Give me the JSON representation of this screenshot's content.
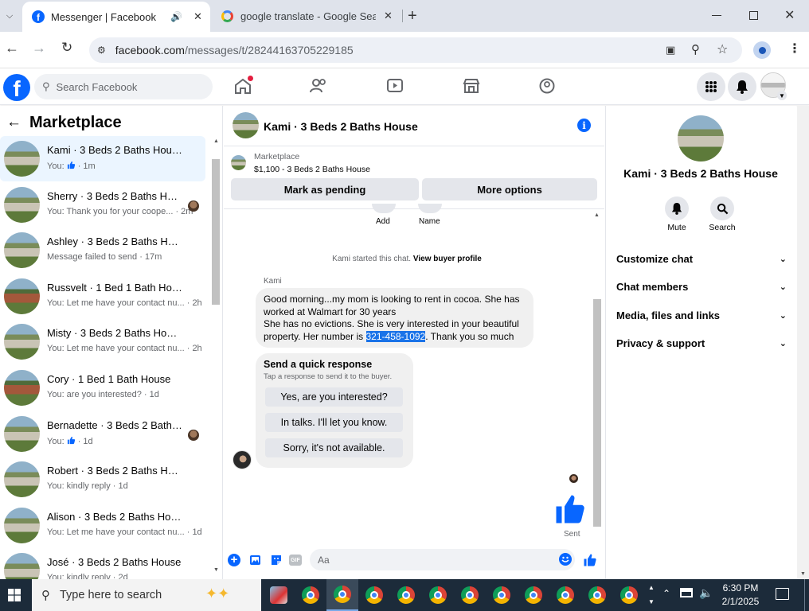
{
  "browser": {
    "tabs": [
      {
        "title": "Messenger | Facebook",
        "active": true
      },
      {
        "title": "google translate - Google Sear",
        "active": false
      }
    ],
    "url_domain": "facebook.com",
    "url_path": "/messages/t/28244163705229185"
  },
  "fb": {
    "search_placeholder": "Search Facebook"
  },
  "sidebar": {
    "title": "Marketplace",
    "conversations": [
      {
        "name": "Kami · 3 Beds 2 Baths House",
        "preview": "You:",
        "time": "· 1m",
        "thumb": "gray",
        "like": true
      },
      {
        "name": "Sherry · 3 Beds 2 Baths House",
        "preview": "You: Thank you for your coope...",
        "time": "· 2m",
        "thumb": "gray"
      },
      {
        "name": "Ashley · 3 Beds 2 Baths House",
        "preview": "Message failed to send",
        "time": "· 17m",
        "thumb": "gray"
      },
      {
        "name": "Russvelt · 1 Bed 1 Bath House",
        "preview": "You: Let me have your contact nu...",
        "time": "· 2h",
        "thumb": "brown"
      },
      {
        "name": "Misty · 3 Beds 2 Baths House",
        "preview": "You: Let me have your contact nu...",
        "time": "· 2h",
        "thumb": "gray"
      },
      {
        "name": "Cory · 1 Bed 1 Bath House",
        "preview": "You: are you interested?",
        "time": "· 1d",
        "thumb": "brown"
      },
      {
        "name": "Bernadette · 3 Beds 2 Baths ...",
        "preview": "You:",
        "time": "· 1d",
        "thumb": "gray",
        "like": true
      },
      {
        "name": "Robert · 3 Beds 2 Baths House",
        "preview": "You: kindly reply",
        "time": "· 1d",
        "thumb": "gray"
      },
      {
        "name": "Alison · 3 Beds 2 Baths House",
        "preview": "You: Let me have your contact nu...",
        "time": "· 1d",
        "thumb": "gray"
      },
      {
        "name": "José · 3 Beds 2 Baths House",
        "preview": "You: kindly reply",
        "time": "· 2d",
        "thumb": "gray"
      }
    ]
  },
  "chat": {
    "title": "Kami · 3 Beds 2 Baths House",
    "listing_source": "Marketplace",
    "listing_title": "$1,100 - 3 Beds 2 Baths House",
    "mark_pending": "Mark as pending",
    "more_options": "More options",
    "top_labels": [
      "Add",
      "Name"
    ],
    "started_text": "Kami started this chat.",
    "view_profile": "View buyer profile",
    "sender": "Kami",
    "message_line1": "Good morning...my mom is looking to rent in cocoa. She has",
    "message_line2": "worked at Walmart for 30 years",
    "message_line3": "She has no evictions. She is very interested in your beautiful",
    "message_line4_pre": "property. Her number is ",
    "message_phone": "321-458-1092",
    "message_line4_post": ". Thank you so much",
    "quick_title": "Send a quick response",
    "quick_subtitle": "Tap a response to send it to the buyer.",
    "quick_responses": [
      "Yes, are you interested?",
      "In talks. I'll let you know.",
      "Sorry, it's not available."
    ],
    "sent_label": "Sent",
    "composer_placeholder": "Aa"
  },
  "details": {
    "name": "Kami · 3 Beds 2 Baths House",
    "mute": "Mute",
    "search": "Search",
    "sections": [
      "Customize chat",
      "Chat members",
      "Media, files and links",
      "Privacy & support"
    ]
  },
  "taskbar": {
    "search_placeholder": "Type here to search",
    "time": "6:30 PM",
    "date": "2/1/2025"
  },
  "colors": {
    "fb_blue": "#0866ff",
    "selection": "#1a73e8"
  }
}
